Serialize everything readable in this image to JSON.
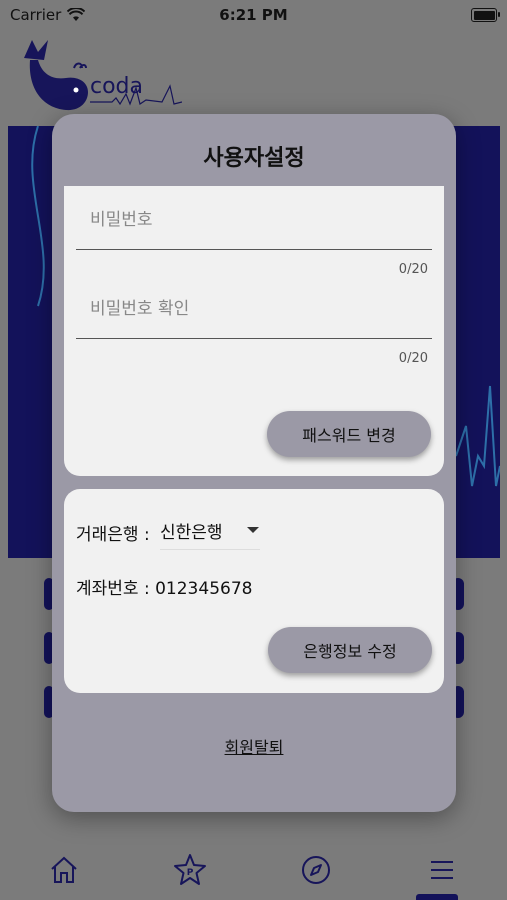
{
  "status_bar": {
    "carrier": "Carrier",
    "time": "6:21 PM"
  },
  "app": {
    "logo_text": "coda"
  },
  "dialog": {
    "title": "사용자설정",
    "password_section": {
      "password_placeholder": "비밀번호",
      "password_counter": "0/20",
      "confirm_placeholder": "비밀번호 확인",
      "confirm_counter": "0/20",
      "change_button": "패스워드 변경"
    },
    "bank_section": {
      "bank_label": "거래은행 :",
      "bank_value": "신한은행",
      "account_label": "계좌번호 :",
      "account_value": "012345678",
      "edit_button": "은행정보 수정"
    },
    "withdraw_link": "회원탈퇴"
  },
  "nav": {
    "items": [
      {
        "icon": "home-icon"
      },
      {
        "icon": "star-p-icon"
      },
      {
        "icon": "compass-icon"
      },
      {
        "icon": "menu-icon"
      }
    ],
    "active_index": 3
  },
  "colors": {
    "brand": "#13125a",
    "dialog": "#9b99a6",
    "card": "#f1f1f1"
  }
}
